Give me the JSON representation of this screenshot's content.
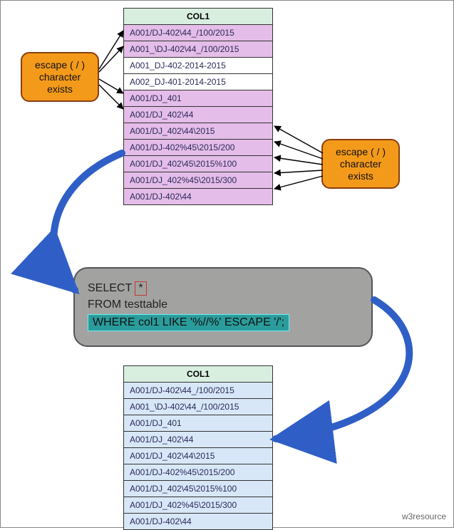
{
  "topTable": {
    "header": "COL1",
    "rows": [
      {
        "v": "A001/DJ-402\\44_/100/2015",
        "hit": true
      },
      {
        "v": "A001_\\DJ-402\\44_/100/2015",
        "hit": true
      },
      {
        "v": "A001_DJ-402-2014-2015",
        "hit": false
      },
      {
        "v": "A002_DJ-401-2014-2015",
        "hit": false
      },
      {
        "v": "A001/DJ_401",
        "hit": true
      },
      {
        "v": "A001/DJ_402\\44",
        "hit": true
      },
      {
        "v": "A001/DJ_402\\44\\2015",
        "hit": true
      },
      {
        "v": "A001/DJ-402%45\\2015/200",
        "hit": true
      },
      {
        "v": "A001/DJ_402\\45\\2015%100",
        "hit": true
      },
      {
        "v": "A001/DJ_402%45\\2015/300",
        "hit": true
      },
      {
        "v": "A001/DJ-402\\44",
        "hit": true
      }
    ]
  },
  "bottomTable": {
    "header": "COL1",
    "rows": [
      {
        "v": "A001/DJ-402\\44_/100/2015"
      },
      {
        "v": "A001_\\DJ-402\\44_/100/2015"
      },
      {
        "v": "A001/DJ_401"
      },
      {
        "v": "A001/DJ_402\\44"
      },
      {
        "v": "A001/DJ_402\\44\\2015"
      },
      {
        "v": "A001/DJ-402%45\\2015/200"
      },
      {
        "v": "A001/DJ_402\\45\\2015%100"
      },
      {
        "v": "A001/DJ_402%45\\2015/300"
      },
      {
        "v": "A001/DJ-402\\44"
      }
    ]
  },
  "sql": {
    "select": "SELECT",
    "star": "*",
    "from": "FROM testtable",
    "where": "WHERE col1   LIKE '%//%' ESCAPE '/';"
  },
  "callouts": {
    "left": "escape ( / )\ncharacter\nexists",
    "right": "escape ( / )\ncharacter\nexists"
  },
  "footer": "w3resource"
}
